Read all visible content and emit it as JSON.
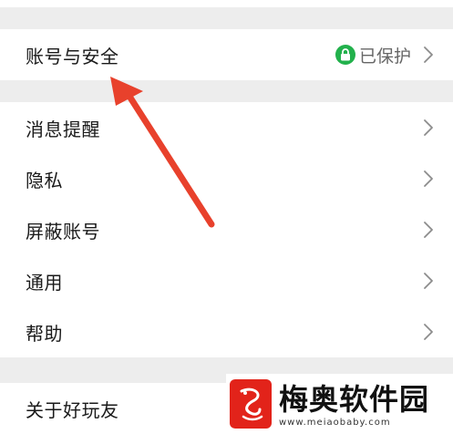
{
  "colors": {
    "background": "#ededed",
    "card": "#ffffff",
    "lock_green": "#22b14c",
    "arrow_red": "#e8412c",
    "watermark_red": "#e2231a"
  },
  "account_row": {
    "label": "账号与安全",
    "status": "已保护",
    "status_icon": "lock-icon"
  },
  "settings": {
    "items": [
      {
        "label": "消息提醒"
      },
      {
        "label": "隐私"
      },
      {
        "label": "屏蔽账号"
      },
      {
        "label": "通用"
      },
      {
        "label": "帮助"
      }
    ]
  },
  "about_row": {
    "label": "关于好玩友"
  },
  "watermark": {
    "title": "梅奥软件园",
    "url": "www.meiaobaby.com"
  }
}
